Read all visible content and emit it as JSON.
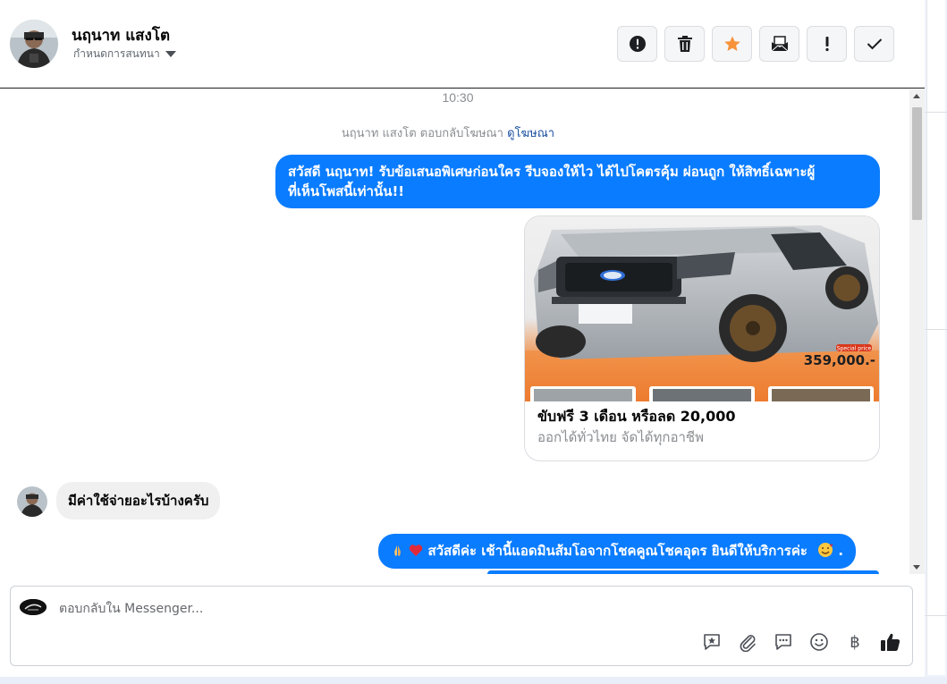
{
  "header": {
    "contact_name": "นฤนาท แสงโต",
    "assign_label": "กำหนดการสนทนา",
    "toolbar": [
      {
        "name": "spam-button",
        "icon": "alert-circle-icon"
      },
      {
        "name": "delete-button",
        "icon": "trash-icon"
      },
      {
        "name": "star-button",
        "icon": "star-icon"
      },
      {
        "name": "mark-unread-button",
        "icon": "envelope-icon"
      },
      {
        "name": "important-button",
        "icon": "exclamation-icon"
      },
      {
        "name": "done-button",
        "icon": "check-icon"
      }
    ]
  },
  "chat": {
    "timestamp": "10:30",
    "ad_note_prefix": "นฤนาท แสงโต ตอบกลับโฆษณา",
    "ad_note_link": "ดูโฆษณา",
    "messages": [
      {
        "direction": "out",
        "text_line1": "สวัสดี นฤนาท! รับข้อเสนอพิเศษก่อนใคร รีบจองให้ไว ได้ไปโคตรคุ้ม ผ่อนถูก ให้สิทธิ์เฉพาะผู้",
        "text_line2": "ที่เห็นโพสนี้เท่านั้น!!"
      },
      {
        "direction": "out",
        "type": "card",
        "card_title": "ขับฟรี 3 เดือน หรือลด 20,000",
        "card_subtitle": "ออกได้ทั่วไทย จัดได้ทุกอาชีพ",
        "price_label": "359,000.-",
        "price_tag": "Special price"
      },
      {
        "direction": "in",
        "text": "มีค่าใช้จ่ายอะไรบ้างครับ"
      },
      {
        "direction": "out",
        "text": "สวัสดีค่ะ เช้านี้แอดมินส้มโอจากโชคคูณโชคอุดร ยินดีให้บริการค่ะ",
        "trailing": "."
      }
    ]
  },
  "composer": {
    "placeholder": "ตอบกลับใน Messenger...",
    "actions": [
      "saved-reply-icon",
      "attachment-icon",
      "chat-bubble-icon",
      "emoji-icon",
      "baht-icon",
      "thumbs-up-icon"
    ],
    "baht_symbol": "฿"
  },
  "colors": {
    "accent": "#0a7cff",
    "star": "#f7923b",
    "incoming_bubble": "#f0f0f0"
  }
}
